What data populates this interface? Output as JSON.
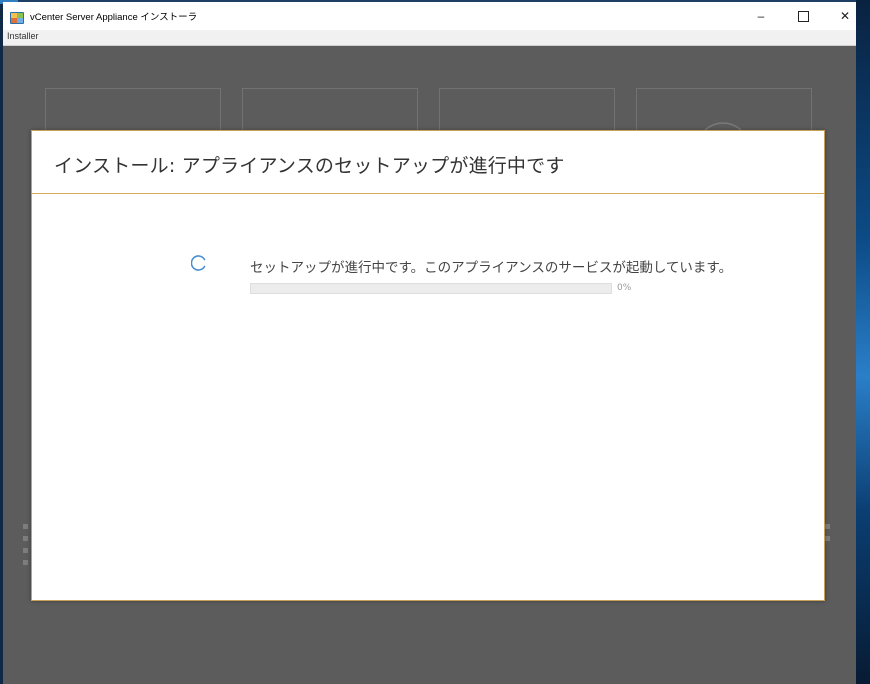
{
  "window": {
    "title": "vCenter Server Appliance インストーラ",
    "minimize_glyph": "–",
    "close_glyph": "✕"
  },
  "menu": {
    "items": [
      "Installer"
    ]
  },
  "dialog": {
    "title": "インストール: アプライアンスのセットアップが進行中です",
    "status_text": "セットアップが進行中です。このアプライアンスのサービスが起動しています。",
    "progress": {
      "percent": 0,
      "label": "0%"
    }
  },
  "icons": {
    "app": "vcenter-installer-icon",
    "spinner": "loading-spinner-icon"
  },
  "colors": {
    "dialog_accent": "#d6a85a",
    "backdrop": "#5c5c5c",
    "spinner": "#4a8fd0"
  }
}
